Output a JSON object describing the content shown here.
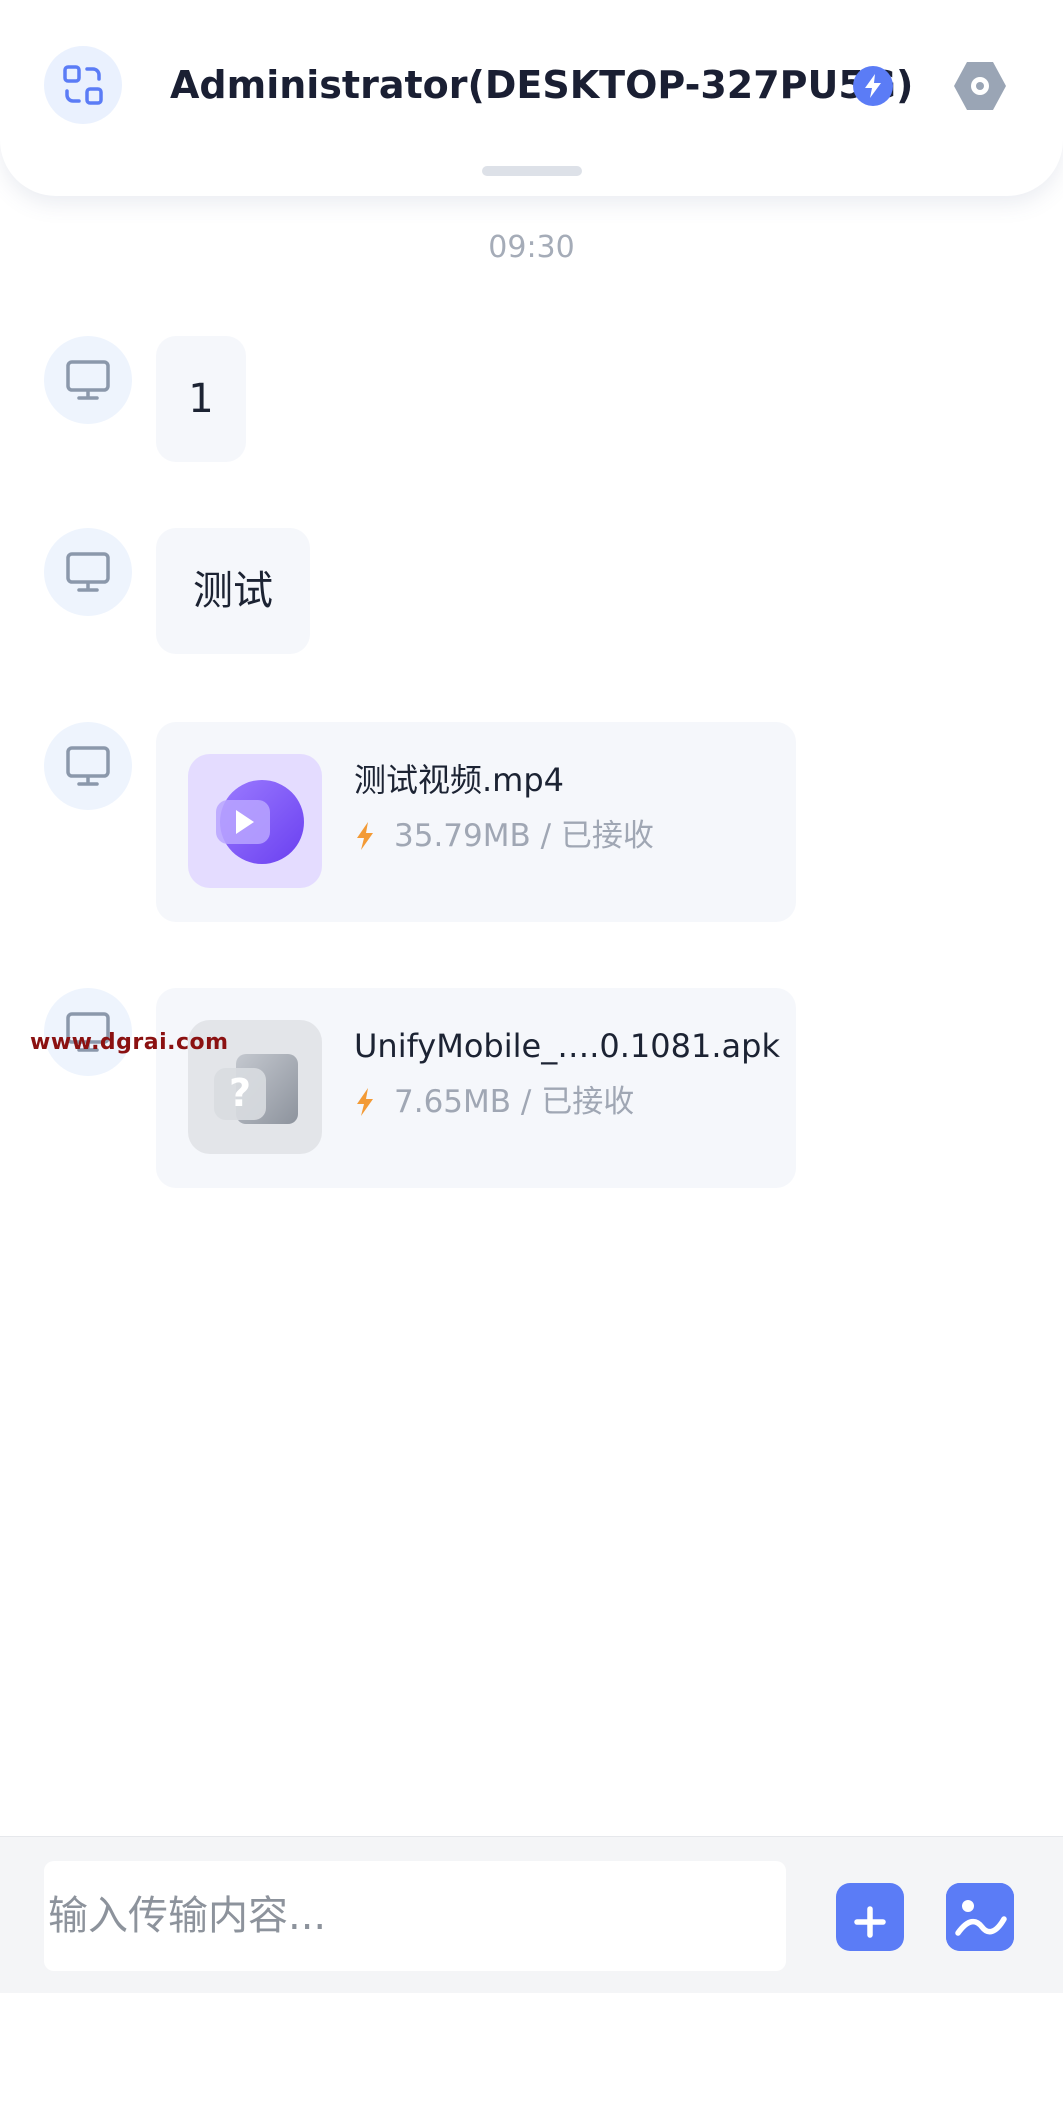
{
  "header": {
    "title": "Administrator(DESKTOP-327PU5G)",
    "switch_icon": "switch-device-icon",
    "bolt_icon": "lightning-icon",
    "settings_icon": "settings-hex-icon"
  },
  "chat": {
    "timestamp": "09:30",
    "messages": [
      {
        "type": "text",
        "text": "1",
        "avatar_icon": "desktop-monitor-icon"
      },
      {
        "type": "text",
        "text": "测试",
        "avatar_icon": "desktop-monitor-icon"
      },
      {
        "type": "file",
        "name": "测试视频.mp4",
        "size": "35.79MB",
        "separator": " / ",
        "status": "已接收",
        "thumb_icon": "video-play-icon"
      },
      {
        "type": "file",
        "name": "UnifyMobile_….0.1081.apk",
        "size": "7.65MB",
        "separator": " / ",
        "status": "已接收",
        "thumb_icon": "unknown-file-icon"
      }
    ]
  },
  "watermark": "www.dgrai.com",
  "input": {
    "placeholder": "输入传输内容..."
  },
  "actions": {
    "file_button_icon": "add-folder-icon",
    "image_button_icon": "image-gallery-icon"
  },
  "colors": {
    "accent": "#5b7cf6",
    "bolt_orange": "#f39a35",
    "bubble_bg": "#f5f7fb",
    "avatar_bg": "#eef4fd"
  }
}
